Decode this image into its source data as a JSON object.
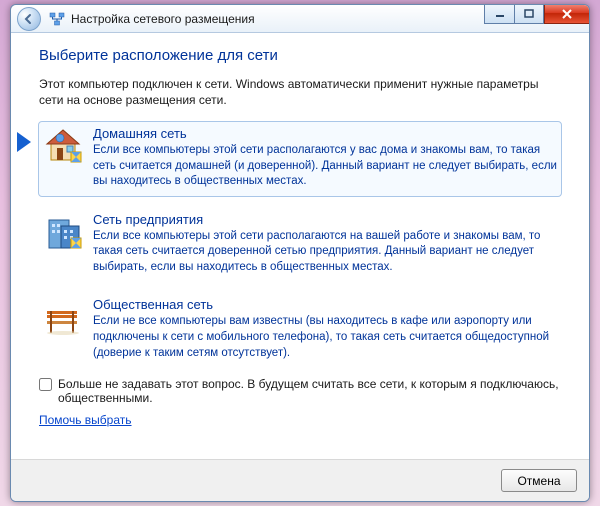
{
  "window": {
    "title": "Настройка сетевого размещения"
  },
  "heading": "Выберите расположение для сети",
  "intro": "Этот компьютер подключен к сети. Windows автоматически применит нужные параметры сети на основе размещения сети.",
  "options": {
    "home": {
      "title": "Домашняя сеть",
      "desc": "Если все компьютеры этой сети располагаются у вас дома и знакомы вам, то такая сеть считается домашней (и доверенной). Данный вариант не следует выбирать, если вы находитесь в общественных местах."
    },
    "work": {
      "title": "Сеть предприятия",
      "desc": "Если все компьютеры этой сети располагаются на вашей работе и знакомы вам, то такая сеть считается доверенной сетью предприятия. Данный вариант не следует выбирать, если вы находитесь в общественных местах."
    },
    "public": {
      "title": "Общественная сеть",
      "desc": "Если не все компьютеры вам известны (вы находитесь в кафе или аэропорту или подключены к сети с мобильного телефона), то такая сеть считается общедоступной (доверие к таким сетям отсутствует)."
    }
  },
  "checkbox_label": "Больше не задавать этот вопрос. В будущем считать все сети, к которым я подключаюсь, общественными.",
  "help_link": "Помочь выбрать",
  "buttons": {
    "cancel": "Отмена"
  }
}
